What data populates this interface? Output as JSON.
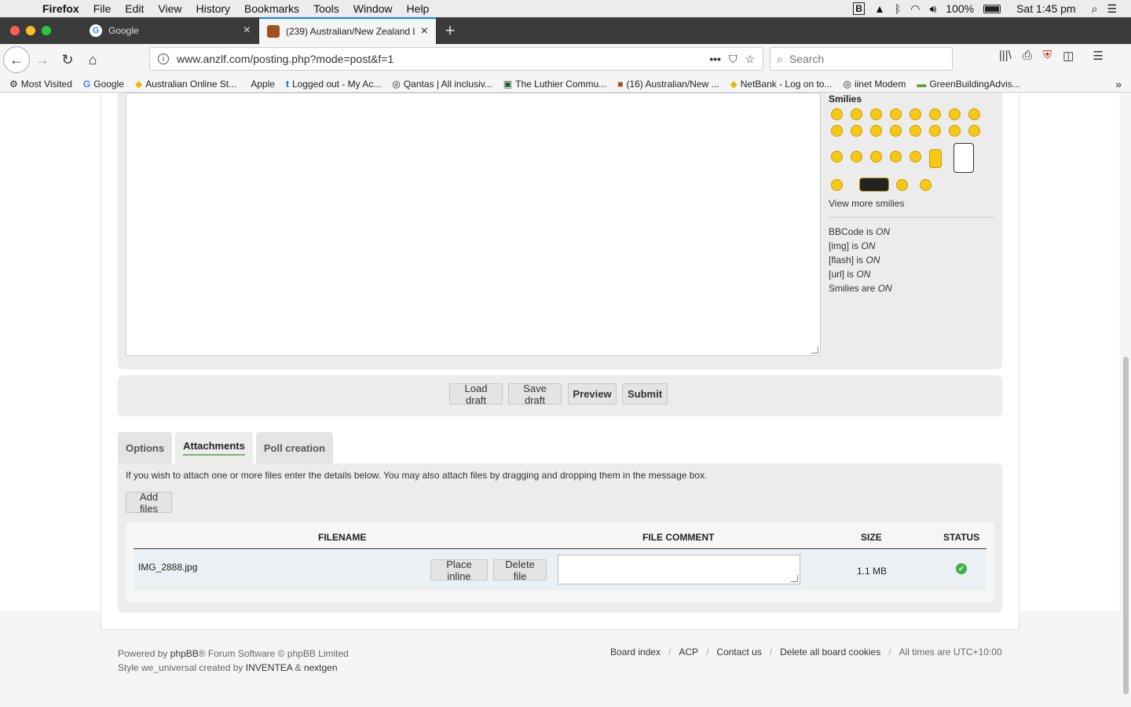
{
  "menubar": {
    "app": "Firefox",
    "items": [
      "File",
      "Edit",
      "View",
      "History",
      "Bookmarks",
      "Tools",
      "Window",
      "Help"
    ],
    "battery": "100%",
    "clock": "Sat 1:45 pm"
  },
  "tabs": [
    {
      "label": "Google",
      "favicon": "G"
    },
    {
      "label": "(239) Australian/New Zealand L",
      "favicon": ""
    }
  ],
  "nav": {
    "url": "www.anzlf.com/posting.php?mode=post&f=1",
    "search_placeholder": "Search"
  },
  "bookmarks": [
    {
      "label": "Most Visited",
      "icon": "⚙"
    },
    {
      "label": "Google",
      "icon": "G"
    },
    {
      "label": "Australian Online St...",
      "icon": "◆"
    },
    {
      "label": "Apple",
      "icon": ""
    },
    {
      "label": "Logged out - My Ac...",
      "icon": "t"
    },
    {
      "label": "Qantas | All inclusiv...",
      "icon": "◎"
    },
    {
      "label": "The Luthier Commu...",
      "icon": "▣"
    },
    {
      "label": "(16) Australian/New ...",
      "icon": "■"
    },
    {
      "label": "NetBank - Log on to...",
      "icon": "◆"
    },
    {
      "label": "iinet Modem",
      "icon": "◎"
    },
    {
      "label": "GreenBuildingAdvis...",
      "icon": "▬"
    }
  ],
  "smilies": {
    "title": "Smilies",
    "view_more": "View more smilies"
  },
  "bbcode_status": [
    {
      "label": "BBCode is",
      "value": "ON"
    },
    {
      "label": "[img] is",
      "value": "ON"
    },
    {
      "label": "[flash] is",
      "value": "ON"
    },
    {
      "label": "[url] is",
      "value": "ON"
    },
    {
      "label": "Smilies are",
      "value": "ON"
    }
  ],
  "buttons": {
    "load_draft": "Load draft",
    "save_draft": "Save draft",
    "preview": "Preview",
    "submit": "Submit"
  },
  "panel_tabs": [
    "Options",
    "Attachments",
    "Poll creation"
  ],
  "attachments": {
    "description": "If you wish to attach one or more files enter the details below. You may also attach files by dragging and dropping them in the message box.",
    "add_files": "Add files",
    "headers": {
      "filename": "FILENAME",
      "comment": "FILE COMMENT",
      "size": "SIZE",
      "status": "STATUS"
    },
    "rows": [
      {
        "filename": "IMG_2888.jpg",
        "place_inline": "Place inline",
        "delete_file": "Delete file",
        "size": "1.1 MB",
        "status": "ok"
      }
    ]
  },
  "footer": {
    "powered_prefix": "Powered by",
    "phpbb": "phpBB",
    "powered_suffix": "® Forum Software © phpBB Limited",
    "style_prefix": "Style we_universal created by",
    "inventea": "INVENTEA",
    "amp": "&",
    "nextgen": "nextgen",
    "links": [
      "Board index",
      "ACP",
      "Contact us",
      "Delete all board cookies"
    ],
    "timezone": "All times are UTC+10:00"
  }
}
